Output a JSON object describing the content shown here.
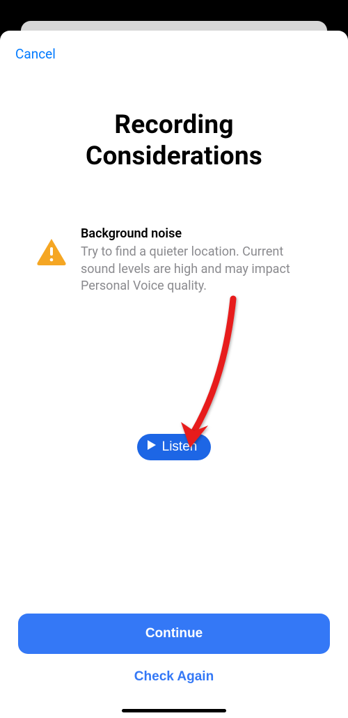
{
  "nav": {
    "cancel_label": "Cancel"
  },
  "title": {
    "line1": "Recording",
    "line2": "Considerations"
  },
  "warning": {
    "title": "Background noise",
    "body": "Try to find a quieter location. Current sound levels are high and may impact Personal Voice quality."
  },
  "buttons": {
    "listen_label": "Listen",
    "continue_label": "Continue",
    "check_again_label": "Check Again"
  },
  "colors": {
    "link": "#007aff",
    "primary": "#3478f6",
    "warning": "#f5a623"
  }
}
